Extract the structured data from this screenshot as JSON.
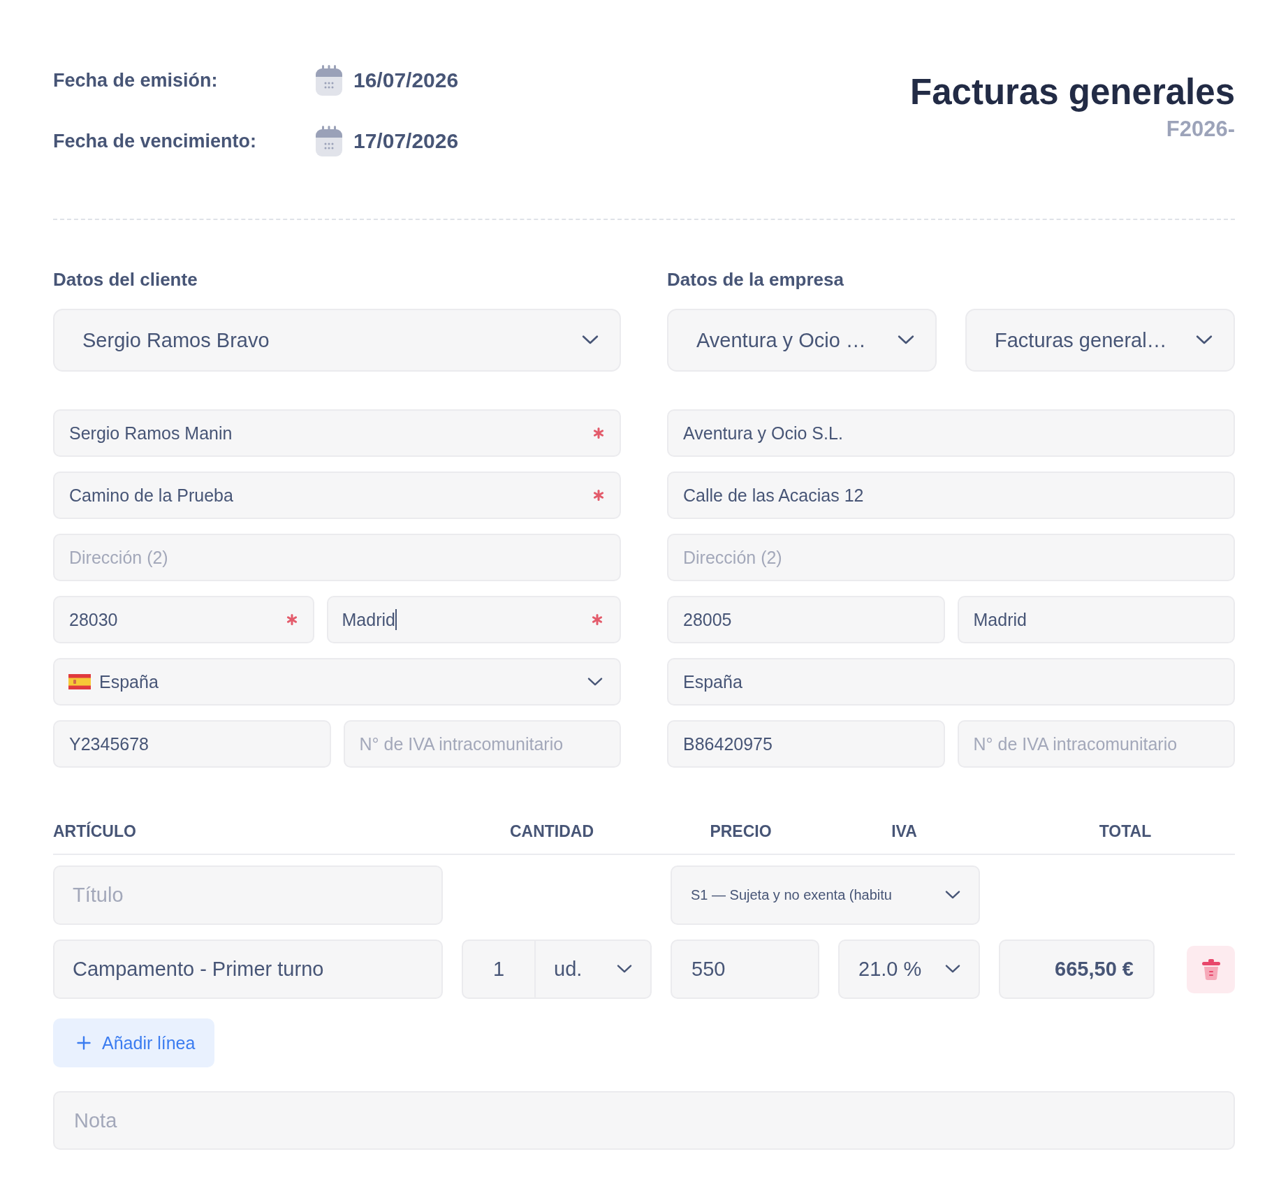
{
  "header": {
    "dates": [
      {
        "label": "Fecha de emisión:",
        "value": "16/07/2026"
      },
      {
        "label": "Fecha de vencimiento:",
        "value": "17/07/2026"
      }
    ],
    "title": "Facturas generales",
    "number": "F2026-"
  },
  "parties": [
    {
      "heading": "Datos del cliente",
      "selectors": [
        "Sergio Ramos Bravo"
      ],
      "rows": [
        [
          {
            "kind": "text",
            "value": "Sergio Ramos Manin",
            "required": true,
            "focused": false
          }
        ],
        [
          {
            "kind": "text",
            "value": "Camino de la Prueba",
            "required": true,
            "focused": false
          }
        ],
        [
          {
            "kind": "text",
            "placeholder": "Dirección (2)",
            "required": false,
            "focused": false
          }
        ],
        [
          {
            "kind": "text",
            "value": "28030",
            "required": true,
            "focused": false
          },
          {
            "kind": "text",
            "value": "Madrid",
            "required": true,
            "focused": true
          }
        ],
        [
          {
            "kind": "country",
            "value": "España",
            "required": false,
            "focused": false
          }
        ],
        [
          {
            "kind": "text",
            "value": "Y2345678",
            "required": false,
            "focused": false
          },
          {
            "kind": "text",
            "placeholder": "N° de IVA intracomunitario",
            "required": false,
            "focused": false
          }
        ]
      ]
    },
    {
      "heading": "Datos de la empresa",
      "selectors": [
        "Aventura y Ocio …",
        "Facturas general…"
      ],
      "rows": [
        [
          {
            "kind": "text",
            "value": "Aventura y Ocio S.L.",
            "required": false,
            "focused": false
          }
        ],
        [
          {
            "kind": "text",
            "value": "Calle de las Acacias 12",
            "required": false,
            "focused": false
          }
        ],
        [
          {
            "kind": "text",
            "placeholder": "Dirección (2)",
            "required": false,
            "focused": false
          }
        ],
        [
          {
            "kind": "text",
            "value": "28005",
            "required": false,
            "focused": false
          },
          {
            "kind": "text",
            "value": "Madrid",
            "required": false,
            "focused": false
          }
        ],
        [
          {
            "kind": "text",
            "value": "España",
            "required": false,
            "focused": false
          }
        ],
        [
          {
            "kind": "text",
            "value": "B86420975",
            "required": false,
            "focused": false
          },
          {
            "kind": "text",
            "placeholder": "N° de IVA intracomunitario",
            "required": false,
            "focused": false
          }
        ]
      ]
    }
  ],
  "table": {
    "columns": [
      "ARTÍCULO",
      "CANTIDAD",
      "PRECIO",
      "IVA",
      "TOTAL"
    ],
    "title_field": {
      "placeholder": "Título"
    },
    "tax_select": "S1 — Sujeta y no exenta (habitu",
    "lines": [
      {
        "article": "Campamento - Primer turno",
        "quantity": "1",
        "unit": "ud.",
        "price": "550",
        "vat": "21.0 %",
        "total": "665,50 €"
      }
    ],
    "add_button": "Añadir línea",
    "note": {
      "placeholder": "Nota"
    }
  }
}
